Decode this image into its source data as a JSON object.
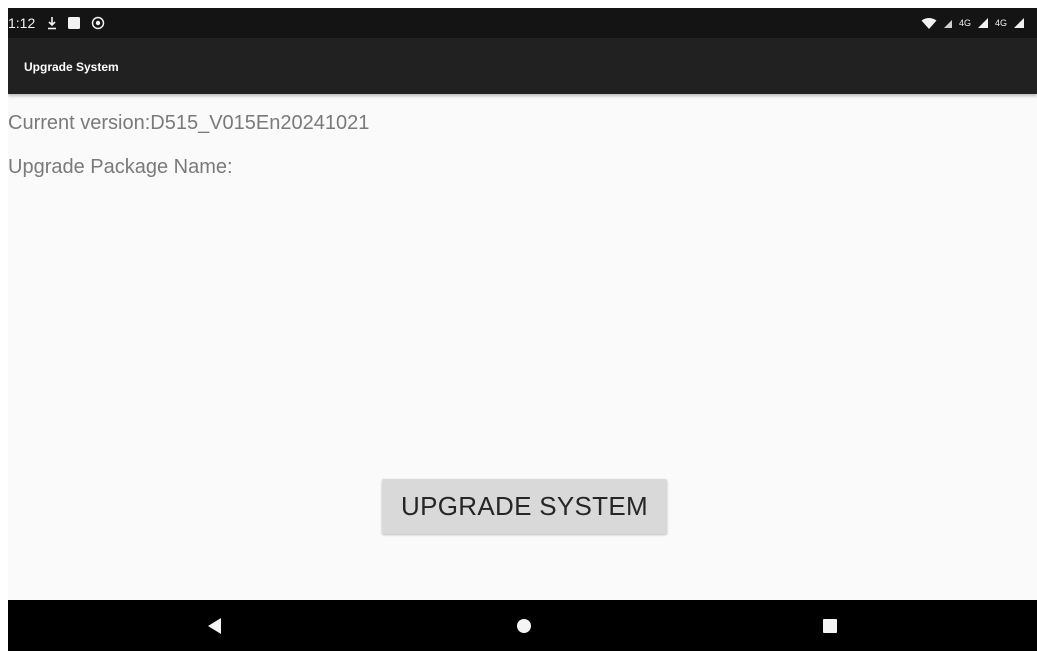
{
  "status_bar": {
    "time": "1:12",
    "icons": [
      "download-icon",
      "square-notification-icon",
      "sync-icon"
    ],
    "right_icons": [
      "wifi-icon",
      "signal-icon",
      "signal-icon"
    ],
    "network_1": "4G",
    "network_2": "4G"
  },
  "action_bar": {
    "title": "Upgrade System"
  },
  "content": {
    "current_version": "Current version:D515_V015En20241021",
    "package_name": "Upgrade Package Name:"
  },
  "upgrade_button": {
    "label": "UPGRADE SYSTEM"
  },
  "nav_bar": {
    "icons": [
      "back-icon",
      "home-icon",
      "recents-icon"
    ]
  },
  "colors": {
    "status_bar": "#141414",
    "action_bar": "#212121",
    "background": "#fafafa",
    "text_secondary": "#7a7a7a",
    "button_bg": "#d9d9d9",
    "nav_bar": "#000000"
  }
}
